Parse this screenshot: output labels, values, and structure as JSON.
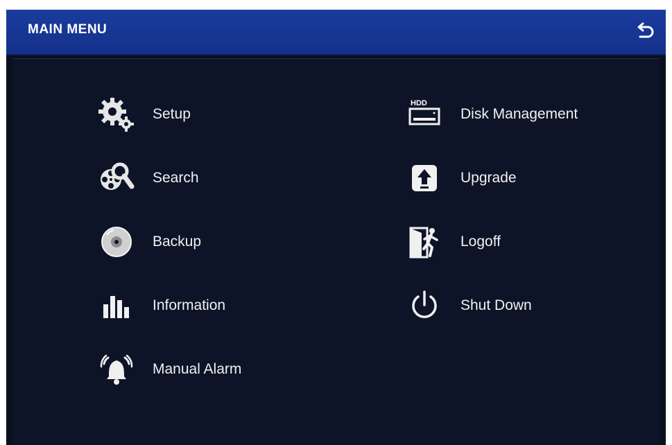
{
  "window": {
    "title": "MAIN MENU"
  },
  "colors": {
    "titlebar": "#1a3c9e",
    "background": "#0b1020",
    "text": "#f1f1f1"
  },
  "menu": {
    "left": [
      {
        "label": "Setup",
        "icon": "gears-icon"
      },
      {
        "label": "Search",
        "icon": "film-reel-search-icon"
      },
      {
        "label": "Backup",
        "icon": "disc-icon"
      },
      {
        "label": "Information",
        "icon": "bar-chart-icon"
      },
      {
        "label": "Manual Alarm",
        "icon": "alarm-bell-icon"
      }
    ],
    "right": [
      {
        "label": "Disk Management",
        "icon": "hdd-icon"
      },
      {
        "label": "Upgrade",
        "icon": "upload-arrow-icon"
      },
      {
        "label": "Logoff",
        "icon": "exit-door-icon"
      },
      {
        "label": "Shut Down",
        "icon": "power-icon"
      }
    ]
  },
  "icons": {
    "hdd_text": "HDD"
  }
}
